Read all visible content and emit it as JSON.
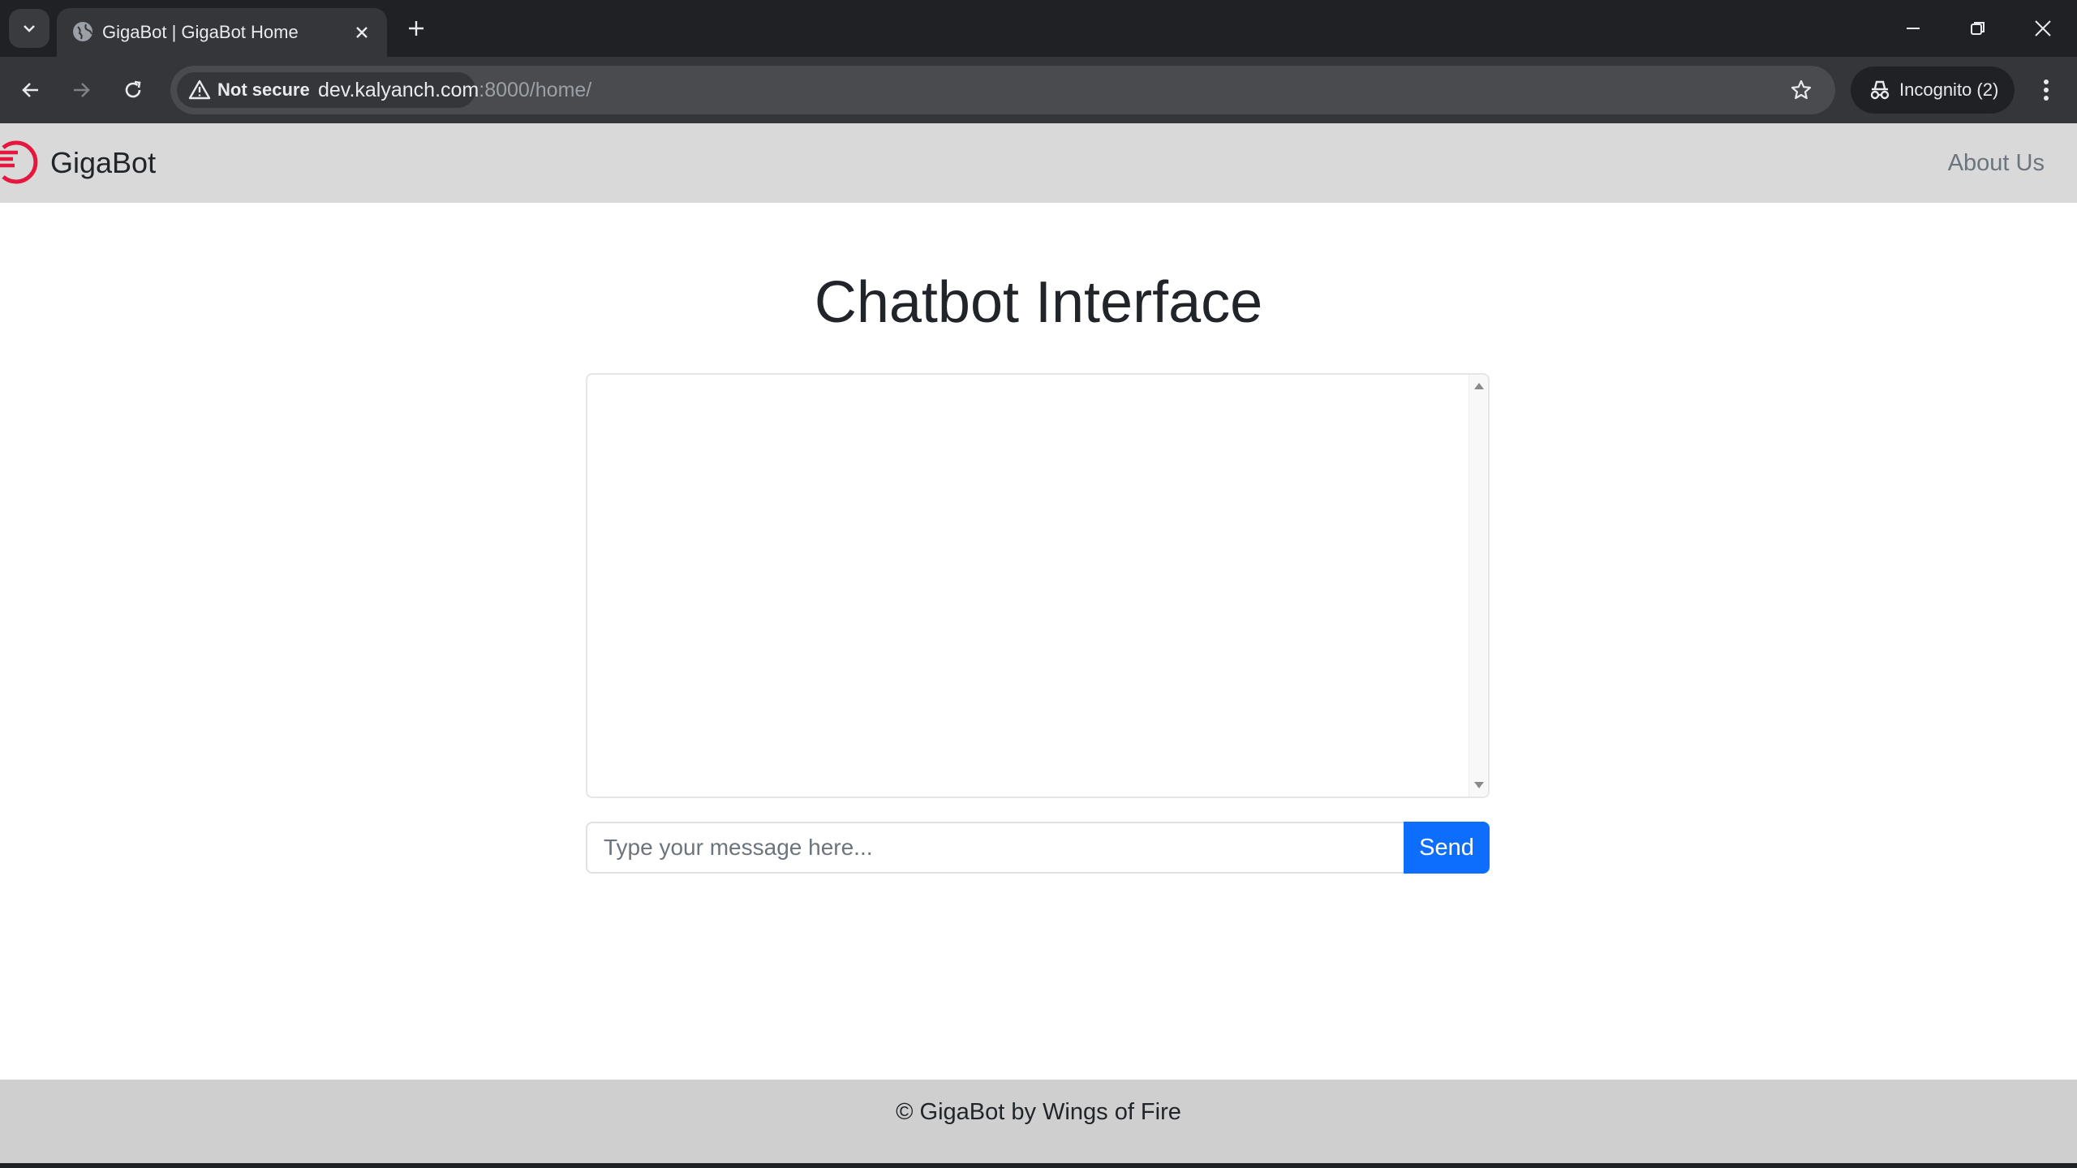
{
  "browser": {
    "tab": {
      "title": "GigaBot | GigaBot Home"
    },
    "toolbar": {
      "security_label": "Not secure",
      "url_host": "dev.kalyanch.com",
      "url_path": ":8000/home/",
      "incognito_label": "Incognito (2)"
    }
  },
  "navbar": {
    "brand": "GigaBot",
    "about_label": "About Us"
  },
  "main": {
    "title": "Chatbot Interface",
    "input_placeholder": "Type your message here...",
    "send_label": "Send"
  },
  "footer": {
    "text": "© GigaBot by Wings of Fire"
  },
  "colors": {
    "send_button": "#0d6efd",
    "navbar_bg": "#d9d9d9",
    "footer_bg": "#cfcfcf",
    "logo_red": "#e5173f"
  },
  "icons": {
    "tab_menu": "chevron-down-icon",
    "favicon": "globe-icon",
    "tab_close": "close-icon",
    "new_tab": "plus-icon",
    "back": "arrow-left-icon",
    "forward": "arrow-right-icon",
    "reload": "reload-icon",
    "security": "warning-icon",
    "bookmark": "star-icon",
    "incognito": "incognito-icon",
    "menu": "kebab-menu-icon",
    "brand": "gigabot-logo-icon"
  }
}
